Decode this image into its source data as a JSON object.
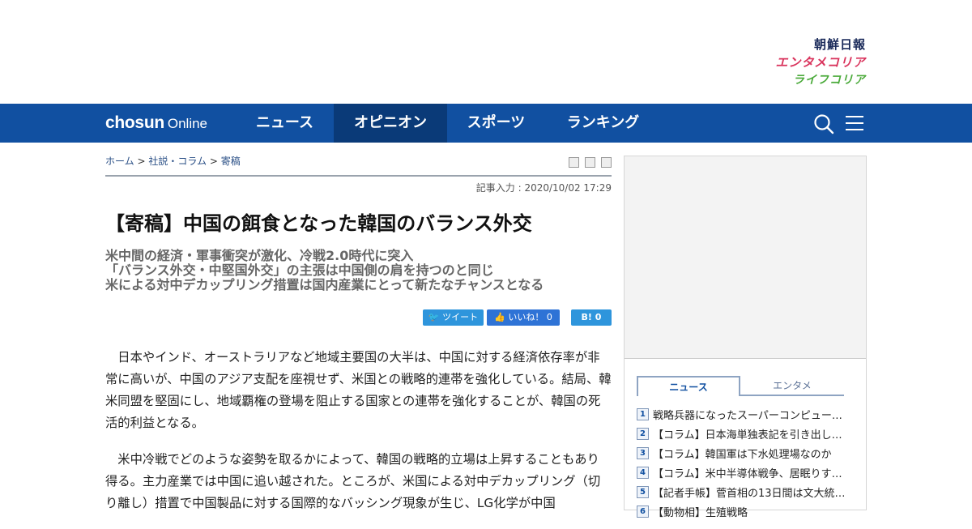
{
  "brands": {
    "chosun_ilbo": "朝鮮日報",
    "entame_korea": "エンタメコリア",
    "life_korea": "ライフコリア"
  },
  "nav": {
    "logo_bold": "chosun",
    "logo_light": "Online",
    "items": [
      "ニュース",
      "オピニオン",
      "スポーツ",
      "ランキング"
    ],
    "active": "オピニオン"
  },
  "breadcrumb": {
    "home": "ホーム",
    "section": "社説・コラム",
    "page": "寄稿",
    "sep": ">"
  },
  "article": {
    "date": "記事入力 : 2020/10/02 17:29",
    "headline": "【寄稿】中国の餌食となった韓国のバランス外交",
    "sub_lines": [
      "米中間の経済・軍事衝突が激化、冷戦2.0時代に突入",
      "「バランス外交・中堅国外交」の主張は中国側の肩を持つのと同じ",
      "米による対中デカップリング措置は国内産業にとって新たなチャンスとなる"
    ],
    "paragraphs": [
      "日本やインド、オーストラリアなど地域主要国の大半は、中国に対する経済依存率が非常に高いが、中国のアジア支配を座視せず、米国との戦略的連帯を強化している。結局、韓米同盟を堅固にし、地域覇権の登場を阻止する国家との連帯を強化することが、韓国の死活的利益となる。",
      "米中冷戦でどのような姿勢を取るかによって、韓国の戦略的立場は上昇することもあり得る。主力産業では中国に追い越された。ところが、米国による対中デカップリング（切り離し）措置で中国製品に対する国際的なバッシング現象が生じ、LG化学が中国"
    ]
  },
  "share": {
    "tweet": "ツイート",
    "like": "いいね！",
    "like_count": "0",
    "hatena": "B!",
    "hatena_count": "0"
  },
  "sidebar": {
    "tabs": [
      "ニュース",
      "エンタメ"
    ],
    "ranking": [
      {
        "n": "1",
        "title": "戦略兵器になったスーパーコンピュー…"
      },
      {
        "n": "2",
        "title": "【コラム】日本海単独表記を引き出し…"
      },
      {
        "n": "3",
        "title": "【コラム】韓国軍は下水処理場なのか"
      },
      {
        "n": "4",
        "title": "【コラム】米中半導体戦争、居眠りす…"
      },
      {
        "n": "5",
        "title": "【記者手帳】菅首相の13日間は文大統…"
      },
      {
        "n": "6",
        "title": "【動物相】生殖戦略"
      }
    ]
  }
}
